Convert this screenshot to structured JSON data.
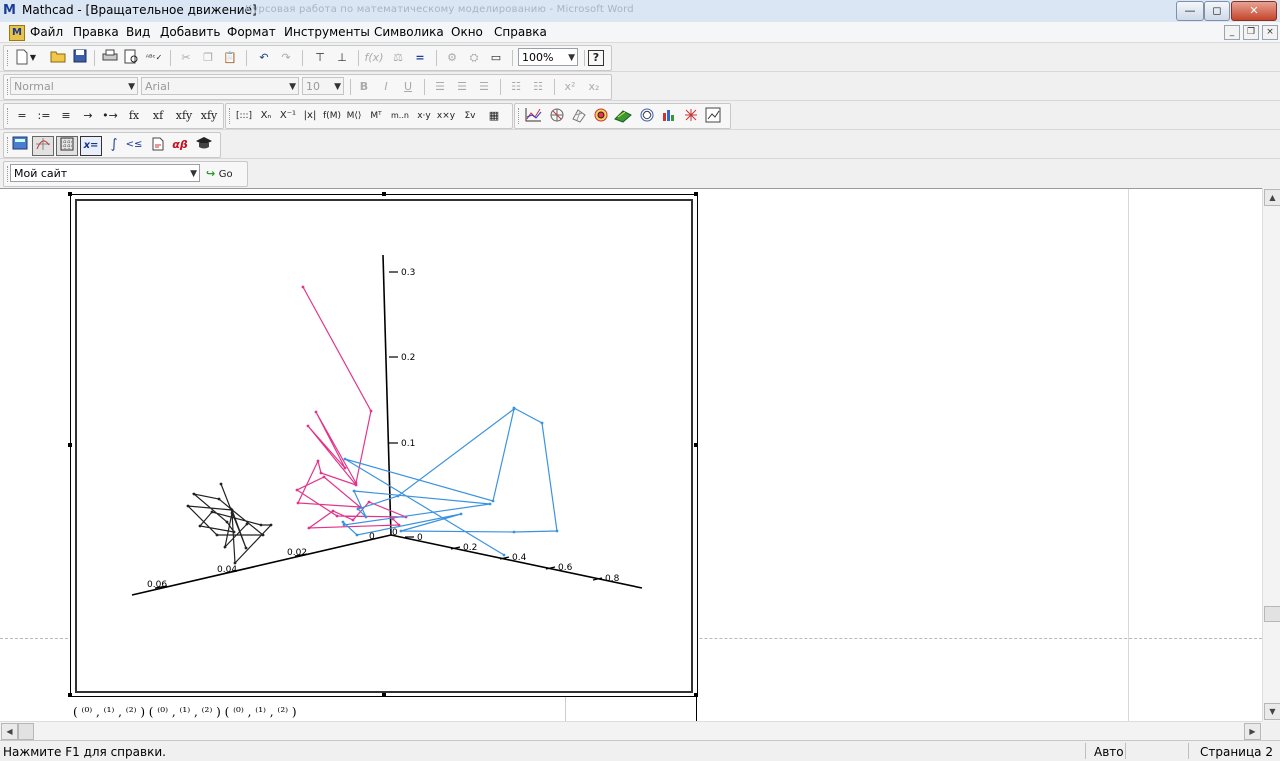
{
  "window": {
    "app_logo": "M",
    "title": "Mathcad - [Вращательное движение]",
    "background_title": "Курсовая работа по математическому моделированию - Microsoft Word",
    "minimize": "—",
    "maximize": "◻",
    "close": "✕"
  },
  "menu": {
    "items": [
      "Файл",
      "Правка",
      "Вид",
      "Добавить",
      "Формат",
      "Инструменты",
      "Символика",
      "Окно",
      "Справка"
    ],
    "doc_minimize": "_",
    "doc_restore": "❐",
    "doc_close": "×"
  },
  "standard_toolbar": {
    "zoom": "100%",
    "help": "?"
  },
  "formatting_toolbar": {
    "style": "Normal",
    "font": "Arial",
    "size": "10",
    "bold": "B",
    "italic": "I",
    "underline": "U",
    "superscript": "x²",
    "subscript": "x₂"
  },
  "math_toolbar": {
    "eval_buttons": [
      "=",
      ":=",
      "≡",
      "→",
      "•→",
      "fx",
      "xf",
      "xfy",
      "xfy"
    ],
    "matrix_buttons": [
      "[:::]",
      "Xₙ",
      "X⁻¹",
      "|x|",
      "f(M)",
      "M⟨⟩",
      "Mᵀ",
      "m..n",
      "x·y",
      "x×y",
      "Σv",
      "▦"
    ],
    "graph_buttons": [
      "xy-plot",
      "polar-plot",
      "surface-plot",
      "contour-plot",
      "3d-scatter",
      "3d-bar",
      "vector-field",
      "graph-toolbar"
    ],
    "palette_buttons": [
      "calculator",
      "graph",
      "matrix",
      "x=",
      "∫",
      "<≤",
      "program",
      "αβ",
      "symbolic"
    ]
  },
  "web_toolbar": {
    "address": "Мой сайт",
    "go_label": "Go"
  },
  "chart_data": {
    "type": "3d-scatter-line",
    "title": "",
    "z_ticks": [
      "0.3",
      "0.2",
      "0.1",
      "0"
    ],
    "x_ticks": [
      "0",
      "0.2",
      "0.4",
      "0.6",
      "0.8"
    ],
    "y_ticks": [
      "0",
      "0.02",
      "0.04",
      "0.06"
    ],
    "series": [
      {
        "color": "#e2358a"
      },
      {
        "color": "#3b93e0"
      },
      {
        "color": "#222222"
      }
    ]
  },
  "formula": {
    "text": "( ⁽⁰⁾ , ⁽¹⁾ , ⁽²⁾ ) ( ⁽⁰⁾ , ⁽¹⁾ , ⁽²⁾ ) ( ⁽⁰⁾ , ⁽¹⁾ , ⁽²⁾ )"
  },
  "status": {
    "help": "Нажмите F1 для справки.",
    "mode": "Авто",
    "page": "Страница 2"
  }
}
